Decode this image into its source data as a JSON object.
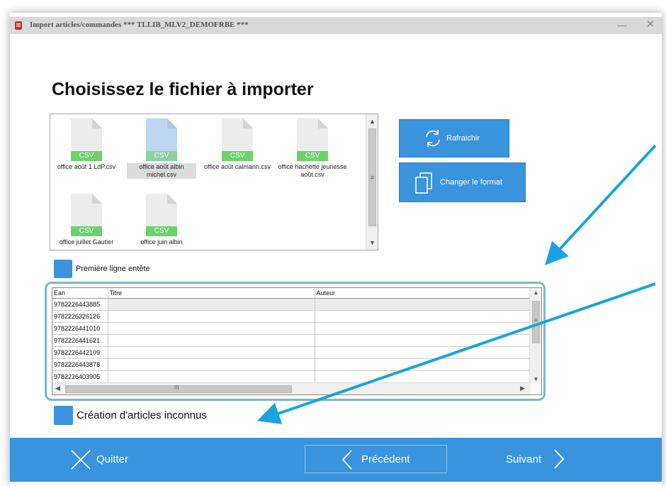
{
  "window": {
    "title": "Import articles/commandes  *** TLLIB_MLV2_DEMOFRBE ***",
    "minimize_glyph": "—",
    "close_glyph": "✕"
  },
  "page_title": "Choisissez le fichier à importer",
  "files": [
    {
      "name": "office août 1 LdP.csv",
      "badge": "CSV",
      "selected": false
    },
    {
      "name": "office août albin michel.csv",
      "badge": "CSV",
      "selected": true
    },
    {
      "name": "office août calmann.csv",
      "badge": "CSV",
      "selected": false
    },
    {
      "name": "office hachette jeunesse août.csv",
      "badge": "CSV",
      "selected": false
    },
    {
      "name": "office juillet Gautier",
      "badge": "CSV",
      "selected": false
    },
    {
      "name": "office juin albin",
      "badge": "CSV",
      "selected": false
    }
  ],
  "buttons": {
    "refresh": "Rafraichir",
    "change_format": "Changer le format"
  },
  "options": {
    "first_line_header": "Première ligne entête",
    "create_unknown": "Création d'articles inconnus"
  },
  "table": {
    "columns": [
      "Ean",
      "Titre",
      "Auteur"
    ],
    "rows": [
      "9782226443885",
      "9782226326126",
      "9782226441010",
      "9782226441621",
      "9782226442109",
      "9782226443878",
      "9782226403905"
    ],
    "hscroll_glyph": "III"
  },
  "footer": {
    "quit": "Quitter",
    "previous": "Précédent",
    "next": "Suivant"
  },
  "colors": {
    "accent": "#3a93dd",
    "csv_badge": "#6bd36b",
    "annotation_arrow": "#1aa3e0",
    "table_highlight": "#7ab8c8"
  },
  "icons": [
    "app-icon",
    "refresh-icon",
    "copy-icon",
    "close-x-icon",
    "chevron-left-icon",
    "chevron-right-icon"
  ]
}
